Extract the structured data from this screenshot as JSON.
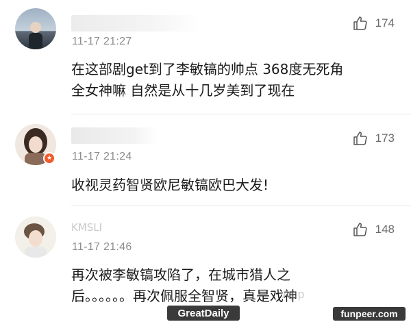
{
  "comments": [
    {
      "username": "",
      "time": "11-17 21:27",
      "text_lines": [
        "在这部剧get到了李敏镐的帅点 368度无死角",
        "全女神嘛  自然是从十几岁美到了现在"
      ],
      "likes": "174"
    },
    {
      "username": "",
      "time": "11-17 21:24",
      "text_lines": [
        "收视灵药智贤欧尼敏镐欧巴大发!"
      ],
      "likes": "173"
    },
    {
      "username": "KMSLI",
      "time": "11-17 21:46",
      "text_lines": [
        "再次被李敏镐攻陷了，在城市猎人之",
        "后。。。。。。再次佩服全智贤，真是戏神"
      ],
      "likes": "148"
    }
  ],
  "watermarks": {
    "left": "GreatDaily",
    "right": "funpeer.com",
    "faint": "App"
  },
  "colors": {
    "badge": "#f25b2a",
    "watermark_bg": "#3a3a3a"
  }
}
